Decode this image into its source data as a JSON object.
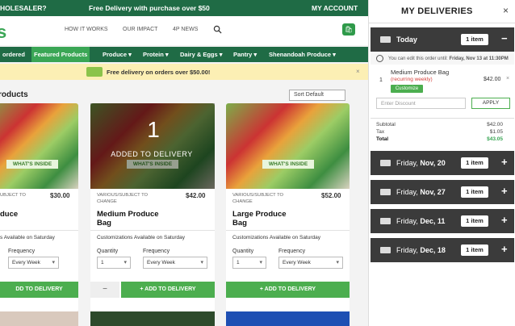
{
  "topbar": {
    "left": "HOLESALER?",
    "center": "Free Delivery with purchase over $50",
    "account": "MY ACCOUNT"
  },
  "header": {
    "logo": "s",
    "nav": [
      "HOW IT WORKS",
      "OUR IMPACT",
      "4P NEWS"
    ]
  },
  "categories": [
    "ordered",
    "Featured Products",
    "Produce ▾",
    "Protein ▾",
    "Dairy & Eggs ▾",
    "Pantry ▾",
    "Shenandoah Produce ▾"
  ],
  "banner": {
    "text": "Free delivery on orders over $50.00!",
    "close": "×"
  },
  "products_section": {
    "title": "roducts",
    "sort": "Sort Default"
  },
  "products": [
    {
      "whats_inside": "WHAT'S INSIDE",
      "subtitle": "UBJECT TO",
      "price": "$30.00",
      "name_line1": "duce",
      "customization": "s Available on Saturday",
      "frequency_label": "Frequency",
      "frequency": "Every Week",
      "add_label": "DD TO DELIVERY"
    },
    {
      "whats_inside": "WHAT'S INSIDE",
      "subtitle": "VARIOUS/SUBJECT TO CHANGE",
      "price": "$42.00",
      "name_line1": "Medium Produce",
      "name_line2": "Bag",
      "customization": "Customizations Available on Saturday",
      "quantity_label": "Quantity",
      "quantity": "1",
      "frequency_label": "Frequency",
      "frequency": "Every Week",
      "minus": "−",
      "add_label": "+ ADD TO DELIVERY",
      "added_count": "1",
      "added_text": "ADDED TO DELIVERY"
    },
    {
      "whats_inside": "WHAT'S INSIDE",
      "subtitle": "VARIOUS/SUBJECT TO CHANGE",
      "price": "$52.00",
      "name_line1": "Large Produce",
      "name_line2": "Bag",
      "customization": "Customizations Available on Saturday",
      "quantity_label": "Quantity",
      "quantity": "1",
      "frequency_label": "Frequency",
      "frequency": "Every Week",
      "add_label": "+ ADD TO DELIVERY"
    }
  ],
  "deliveries": {
    "title": "MY DELIVERIES",
    "close": "×",
    "today": {
      "label": "Today",
      "count": "1 item",
      "toggle": "−"
    },
    "edit_note_prefix": "You can edit this order until:",
    "edit_note_deadline": "Friday, Nov 13 at 11:30PM",
    "line_item": {
      "qty": "1",
      "name": "Medium Produce Bag",
      "recurring": "(recurring weekly)",
      "customize": "Customize",
      "price": "$42.00",
      "remove": "×"
    },
    "discount_placeholder": "Enter Discount",
    "apply": "APPLY",
    "totals": [
      {
        "label": "Subtotal",
        "value": "$42.00"
      },
      {
        "label": "Tax",
        "value": "$1.05"
      },
      {
        "label": "Total",
        "value": "$43.05"
      }
    ],
    "upcoming": [
      {
        "prefix": "Friday,",
        "date": "Nov, 20",
        "count": "1 item",
        "toggle": "+"
      },
      {
        "prefix": "Friday,",
        "date": "Nov, 27",
        "count": "1 item",
        "toggle": "+"
      },
      {
        "prefix": "Friday,",
        "date": "Dec, 11",
        "count": "1 item",
        "toggle": "+"
      },
      {
        "prefix": "Friday,",
        "date": "Dec, 18",
        "count": "1 item",
        "toggle": "+"
      }
    ]
  }
}
